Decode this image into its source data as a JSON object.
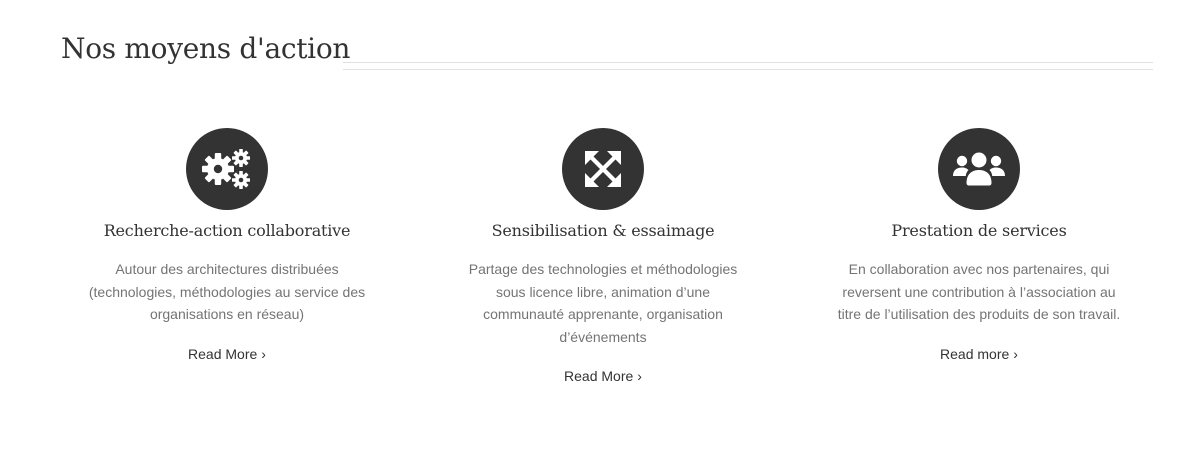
{
  "section": {
    "title": "Nos moyens d'action"
  },
  "columns": [
    {
      "icon": "gears-icon",
      "title": "Recherche-action collaborative",
      "text": "Autour des architectures distribuées (technologies, méthodologies au service des organisations en réseau)",
      "link": "Read More",
      "chevron": "›"
    },
    {
      "icon": "expand-arrows-icon",
      "title": "Sensibilisation & essaimage",
      "text": "Partage des technologies et méthodologies sous licence libre, animation d’une communauté apprenante, organisation d’événements",
      "link": "Read More",
      "chevron": "›"
    },
    {
      "icon": "users-icon",
      "title": "Prestation de services",
      "text": "En collaboration avec nos partenaires, qui reversent une contribution à l’association au titre de l’utilisation des produits de son travail.",
      "link": "Read more",
      "chevron": "›"
    }
  ],
  "colors": {
    "icon_bg": "#333333",
    "icon_fg": "#ffffff",
    "title": "#333333",
    "body_text": "#747474",
    "rule": "#e1e1e1"
  }
}
